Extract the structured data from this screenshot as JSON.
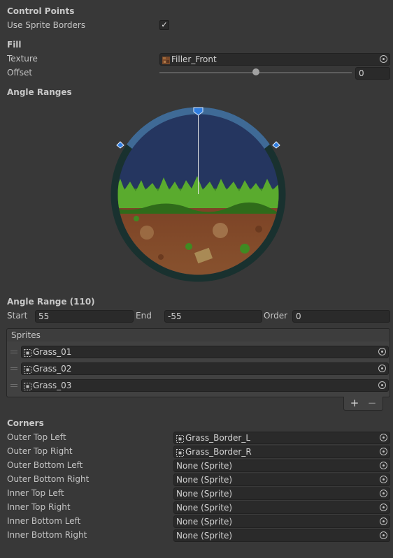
{
  "control_points": {
    "heading": "Control Points",
    "use_sprite_borders_label": "Use Sprite Borders",
    "use_sprite_borders_checked": true,
    "checkmark": "✓"
  },
  "fill": {
    "heading": "Fill",
    "texture_label": "Texture",
    "texture_value": "Filler_Front",
    "offset_label": "Offset",
    "offset_value": "0",
    "offset_slider_fraction": 0.5
  },
  "angle_ranges": {
    "heading": "Angle Ranges"
  },
  "angle_range": {
    "heading": "Angle Range (110)",
    "start_label": "Start",
    "start_value": "55",
    "end_label": "End",
    "end_value": "-55",
    "order_label": "Order",
    "order_value": "0"
  },
  "sprites": {
    "header": "Sprites",
    "items": [
      "Grass_01",
      "Grass_02",
      "Grass_03"
    ],
    "add_label": "+",
    "remove_label": "−"
  },
  "corners": {
    "heading": "Corners",
    "rows": [
      {
        "label": "Outer Top Left",
        "value": "Grass_Border_L",
        "has_icon": true
      },
      {
        "label": "Outer Top Right",
        "value": "Grass_Border_R",
        "has_icon": true
      },
      {
        "label": "Outer Bottom Left",
        "value": "None (Sprite)",
        "has_icon": false
      },
      {
        "label": "Outer Bottom Right",
        "value": "None (Sprite)",
        "has_icon": false
      },
      {
        "label": "Inner Top Left",
        "value": "None (Sprite)",
        "has_icon": false
      },
      {
        "label": "Inner Top Right",
        "value": "None (Sprite)",
        "has_icon": false
      },
      {
        "label": "Inner Bottom Left",
        "value": "None (Sprite)",
        "has_icon": false
      },
      {
        "label": "Inner Bottom Right",
        "value": "None (Sprite)",
        "has_icon": false
      }
    ]
  },
  "colors": {
    "panel_bg": "#383838",
    "field_bg": "#2a2a2a",
    "ring_dark": "#19312f",
    "ring_selected": "#3f6a96",
    "sky": "#253660",
    "handle_blue": "#2f7de0"
  }
}
